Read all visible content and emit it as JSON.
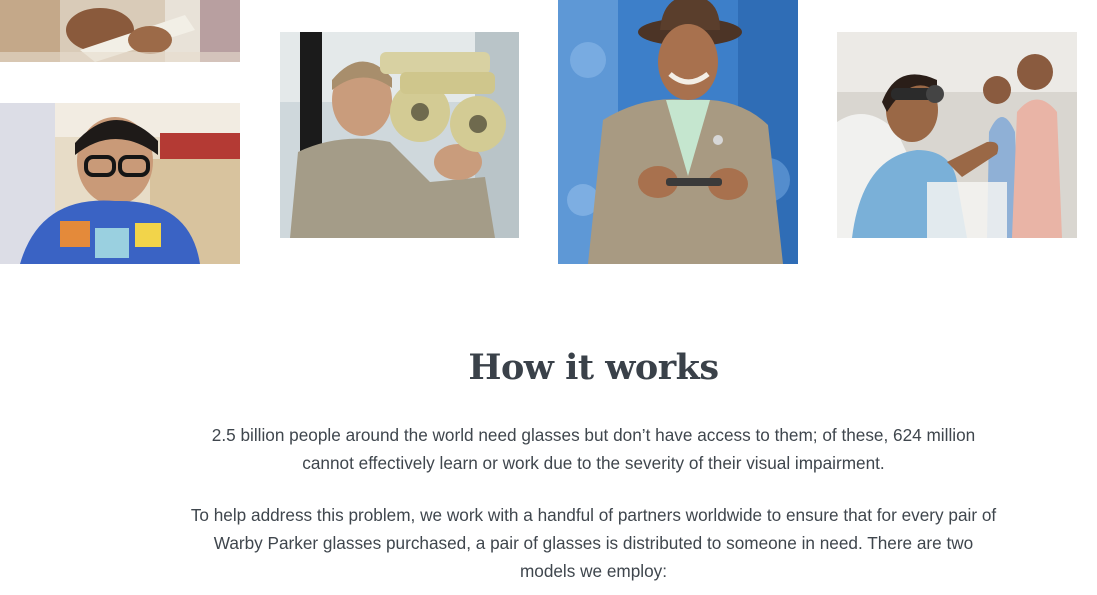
{
  "section": {
    "title": "How it works",
    "paragraphs": [
      "2.5 billion people around the world need glasses but don’t have access to them; of these, 624 million cannot effectively learn or work due to the severity of their visual impairment.",
      "To help address this problem, we work with a handful of partners worldwide to ensure that for every pair of Warby Parker glasses purchased, a pair of glasses is distributed to someone in need. There are two models we employ:"
    ]
  },
  "photos": [
    {
      "name": "photo-hands-with-paper"
    },
    {
      "name": "photo-boy-in-glasses"
    },
    {
      "name": "photo-optometrist-with-phoropter"
    },
    {
      "name": "photo-smiling-man-with-hat"
    },
    {
      "name": "photo-girl-eye-test"
    }
  ],
  "colors": {
    "heading": "#3a4149",
    "body_text": "#3f464d",
    "background": "#ffffff"
  }
}
